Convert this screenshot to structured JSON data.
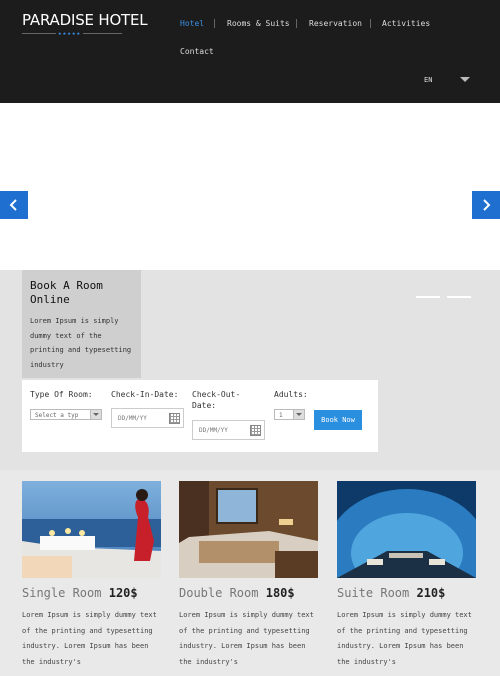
{
  "header": {
    "logo_text": "PARADISE HOTEL",
    "logo_stars": "★★★★★",
    "nav": [
      "Hotel",
      "Rooms & Suits",
      "Reservation",
      "Activities",
      "Contact"
    ],
    "language": "EN"
  },
  "slider": {
    "prev_icon": "chevron-left-icon",
    "next_icon": "chevron-right-icon"
  },
  "booking": {
    "title": "Book A Room Online",
    "description": "Lorem Ipsum is simply dummy text of the printing and typesetting industry",
    "type_label": "Type Of Room:",
    "type_value": "Select a typ",
    "checkin_label": "Check-In-Date:",
    "checkin_placeholder": "DD/MM/YY",
    "checkout_label": "Check-Out-Date:",
    "checkout_placeholder": "DD/MM/YY",
    "adults_label": "Adults:",
    "adults_value": "1",
    "button": "Book Now"
  },
  "rooms": [
    {
      "name": "Single Room",
      "price": "120$",
      "desc": "Lorem Ipsum is simply dummy text of the printing and typesetting industry. Lorem Ipsum has been the industry's"
    },
    {
      "name": "Double Room",
      "price": "180$",
      "desc": "Lorem Ipsum is simply dummy text of the printing and typesetting industry. Lorem Ipsum has been the industry's"
    },
    {
      "name": "Suite Room",
      "price": "210$",
      "desc": "Lorem Ipsum is simply dummy text of the printing and typesetting industry. Lorem Ipsum has been the industry's"
    }
  ],
  "colors": {
    "header_bg": "#1c1c1c",
    "accent": "#2b8fe0",
    "nav_active": "#3b8fe3"
  }
}
